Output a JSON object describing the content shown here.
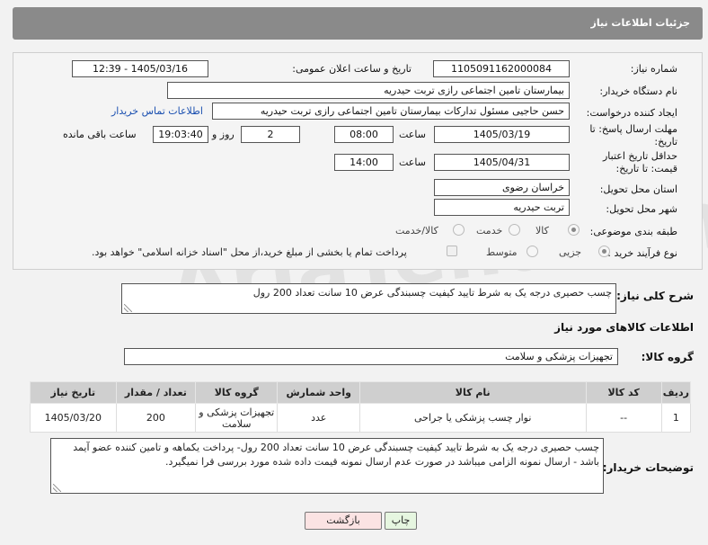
{
  "header": {
    "title": "جزئیات اطلاعات نیاز"
  },
  "form": {
    "need_number_label": "شماره نیاز:",
    "need_number": "1105091162000084",
    "announce_label": "تاریخ و ساعت اعلان عمومی:",
    "announce_value": "1405/03/16 - 12:39",
    "buyer_org_label": "نام دستگاه خریدار:",
    "buyer_org": "بیمارستان تامین اجتماعی رازی تربت حیدریه",
    "creator_label": "ایجاد کننده درخواست:",
    "creator": "حسن حاجیی مسئول تدارکات بیمارستان تامین اجتماعی رازی تربت حیدریه",
    "contact_link": "اطلاعات تماس خریدار",
    "reply_deadline_label": "مهلت ارسال پاسخ: تا تاریخ:",
    "reply_date": "1405/03/19",
    "time_label": "ساعت",
    "reply_time": "08:00",
    "days_value": "2",
    "days_label": "روز و",
    "remaining_time": "19:03:40",
    "remaining_label": "ساعت باقی مانده",
    "price_validity_label": "حداقل تاریخ اعتبار قیمت: تا تاریخ:",
    "price_date": "1405/04/31",
    "price_time_label": "ساعت",
    "price_time": "14:00",
    "province_label": "استان محل تحویل:",
    "province": "خراسان رضوی",
    "city_label": "شهر محل تحویل:",
    "city": "تربت حیدریه",
    "category_label": "طبقه بندی موضوعی:",
    "category_options": [
      "کالا",
      "خدمت",
      "کالا/خدمت"
    ],
    "process_label": "نوع فرآیند خرید :",
    "process_options": [
      "جزیی",
      "متوسط"
    ],
    "payment_note": "پرداخت تمام یا بخشی از مبلغ خرید،از محل \"اسناد خزانه اسلامی\" خواهد بود."
  },
  "summary": {
    "label": "شرح کلی نیاز:",
    "text": "چسب حصیری درجه یک به شرط تایید کیفیت چسبندگی عرض 10 سانت تعداد 200 رول"
  },
  "goods": {
    "section_title": "اطلاعات کالاهای مورد نیاز",
    "group_label": "گروه کالا:",
    "group_value": "تجهیزات پزشکی و سلامت",
    "columns": [
      "ردیف",
      "کد کالا",
      "نام کالا",
      "واحد شمارش",
      "گروه کالا",
      "تعداد / مقدار",
      "تاریخ نیاز"
    ],
    "rows": [
      {
        "row": "1",
        "code": "--",
        "name": "نوار چسب پزشکی یا جراحی",
        "unit": "عدد",
        "group": "تجهیزات پزشکی و سلامت",
        "qty": "200",
        "date": "1405/03/20"
      }
    ]
  },
  "buyer_notes": {
    "label": "توضیحات خریدار:",
    "text": "چسب حصیری درجه یک به شرط تایید کیفیت چسبندگی عرض 10 سانت تعداد 200 رول- پرداخت یکماهه و تامین کننده عضو آیمد باشد - ارسال نمونه الزامی میباشد  در صورت عدم ارسال نمونه قیمت داده شده مورد بررسی قرا نمیگیرد."
  },
  "buttons": {
    "print": "چاپ",
    "back": "بازگشت"
  },
  "watermark": "AriaTender.neT",
  "colors": {
    "header_bg": "#8a8a8a",
    "print_bg": "#e6f6e0",
    "back_bg": "#fbe3e3",
    "link": "#1a4fb0"
  }
}
